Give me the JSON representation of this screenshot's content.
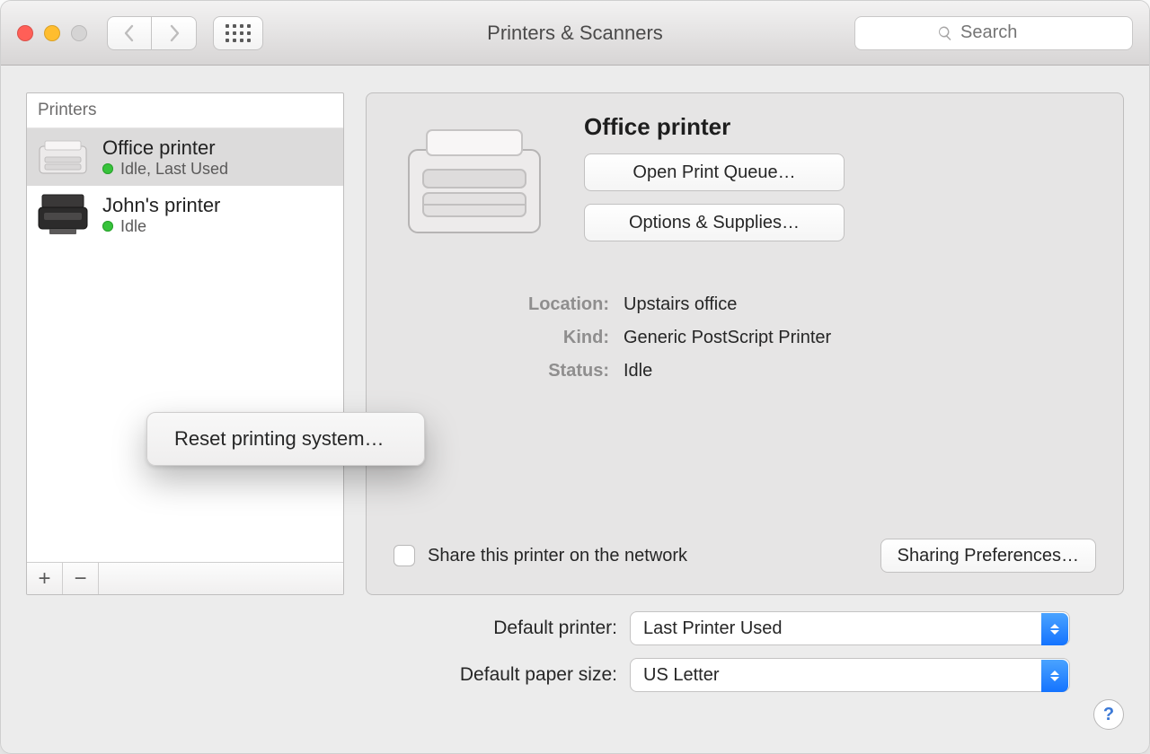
{
  "window": {
    "title": "Printers & Scanners"
  },
  "toolbar": {
    "search_placeholder": "Search"
  },
  "sidebar": {
    "header": "Printers",
    "items": [
      {
        "name": "Office printer",
        "status": "Idle, Last Used",
        "selected": true,
        "icon": "laser"
      },
      {
        "name": "John's printer",
        "status": "Idle",
        "selected": false,
        "icon": "mfp"
      }
    ]
  },
  "context_menu": {
    "item": "Reset printing system…"
  },
  "detail": {
    "name": "Office printer",
    "open_queue": "Open Print Queue…",
    "options": "Options & Supplies…",
    "rows": {
      "location_label": "Location:",
      "location_value": "Upstairs office",
      "kind_label": "Kind:",
      "kind_value": "Generic PostScript Printer",
      "status_label": "Status:",
      "status_value": "Idle"
    },
    "share_label": "Share this printer on the network",
    "sharing_btn": "Sharing Preferences…"
  },
  "defaults": {
    "printer_label": "Default printer:",
    "printer_value": "Last Printer Used",
    "paper_label": "Default paper size:",
    "paper_value": "US Letter"
  },
  "help": "?"
}
